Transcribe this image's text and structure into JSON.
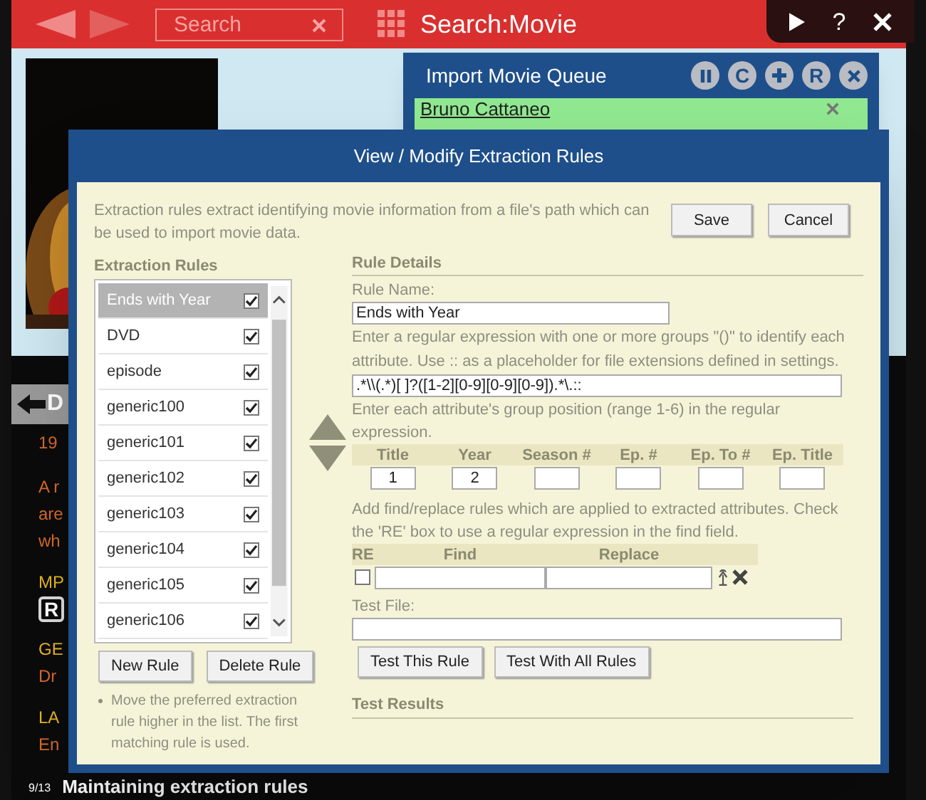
{
  "app_bar": {
    "search": {
      "placeholder": "Search"
    },
    "title": "Search:Movie",
    "help": "?"
  },
  "import_queue": {
    "title": "Import Movie Queue",
    "controls": [
      {
        "kind": "pause"
      },
      {
        "kind": "letter",
        "text": "C"
      },
      {
        "kind": "add"
      },
      {
        "kind": "letter",
        "text": "R"
      },
      {
        "kind": "remove"
      }
    ],
    "items": [
      {
        "name": "Bruno Cattaneo"
      }
    ]
  },
  "movie_details": {
    "back_label": "D",
    "fragments": [
      {
        "kind": "text",
        "text": "19"
      },
      {
        "kind": "text",
        "text": "A r"
      },
      {
        "kind": "text",
        "text": "are"
      },
      {
        "kind": "text",
        "text": "wh"
      },
      {
        "kind": "heading",
        "text": "MP"
      },
      {
        "kind": "badge",
        "text": "R"
      },
      {
        "kind": "heading",
        "text": "GE"
      },
      {
        "kind": "text",
        "text": "Dr"
      },
      {
        "kind": "heading",
        "text": "LA"
      },
      {
        "kind": "text",
        "text": "En"
      }
    ]
  },
  "status_bar": {
    "position": "9/13",
    "caption": "Maintaining extraction rules"
  },
  "dialog": {
    "title": "View / Modify Extraction Rules",
    "description": "Extraction rules extract identifying movie information from a file's path which can be used to import movie data.",
    "buttons": [
      "Save",
      "Cancel"
    ],
    "rules_heading": "Extraction Rules",
    "rules": [
      {
        "name": "Ends with Year",
        "enabled": true,
        "selected": true
      },
      {
        "name": "DVD",
        "enabled": true,
        "selected": false
      },
      {
        "name": "episode",
        "enabled": true,
        "selected": false
      },
      {
        "name": "generic100",
        "enabled": true,
        "selected": false
      },
      {
        "name": "generic101",
        "enabled": true,
        "selected": false
      },
      {
        "name": "generic102",
        "enabled": true,
        "selected": false
      },
      {
        "name": "generic103",
        "enabled": true,
        "selected": false
      },
      {
        "name": "generic104",
        "enabled": true,
        "selected": false
      },
      {
        "name": "generic105",
        "enabled": true,
        "selected": false
      },
      {
        "name": "generic106",
        "enabled": true,
        "selected": false
      }
    ],
    "rule_buttons": [
      "New Rule",
      "Delete Rule"
    ],
    "note": "Move the preferred extraction rule higher in the list. The first matching rule is used.",
    "details_heading": "Rule Details",
    "rule_name_label": "Rule Name:",
    "rule_name": "Ends with Year",
    "regex_help": "Enter a regular expression with one or more groups \"()\" to identify each attribute. Use :: as a placeholder for file extensions defined in settings.",
    "regex": ".*\\\\(.*)[ ]?([1-2][0-9][0-9][0-9]).*\\.::",
    "groups_help": "Enter each attribute's group position (range 1-6) in the regular expression.",
    "groups": [
      {
        "label": "Title",
        "value": "1"
      },
      {
        "label": "Year",
        "value": "2"
      },
      {
        "label": "Season #"
      },
      {
        "label": "Ep. #"
      },
      {
        "label": "Ep. To #"
      },
      {
        "label": "Ep. Title"
      }
    ],
    "replace_help": "Add find/replace rules which are applied to extracted attributes. Check the 'RE' box to use a regular expression in the find field.",
    "replace_columns": [
      "RE",
      "Find",
      "Replace"
    ],
    "replace_rows": [
      {
        "regex": false
      }
    ],
    "test_file_label": "Test File:",
    "test_buttons": [
      "Test This Rule",
      "Test With All Rules"
    ],
    "results_heading": "Test Results"
  }
}
